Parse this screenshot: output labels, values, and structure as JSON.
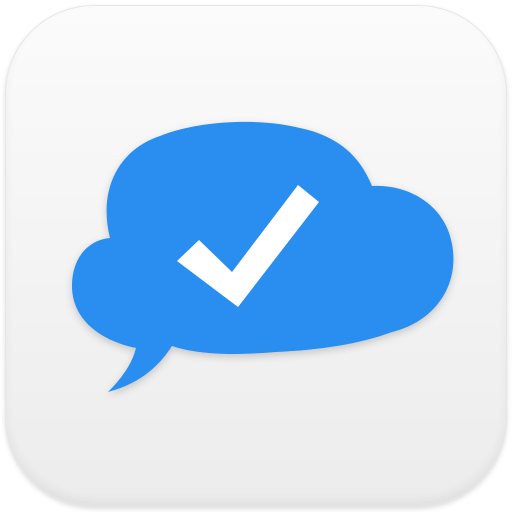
{
  "app_icon": {
    "icon": "cloud-speech-bubble-check-icon",
    "colors": {
      "tile_top": "#fbfbfb",
      "tile_bottom": "#ececec",
      "cloud": "#2b8ef0",
      "checkmark": "#ffffff"
    }
  }
}
